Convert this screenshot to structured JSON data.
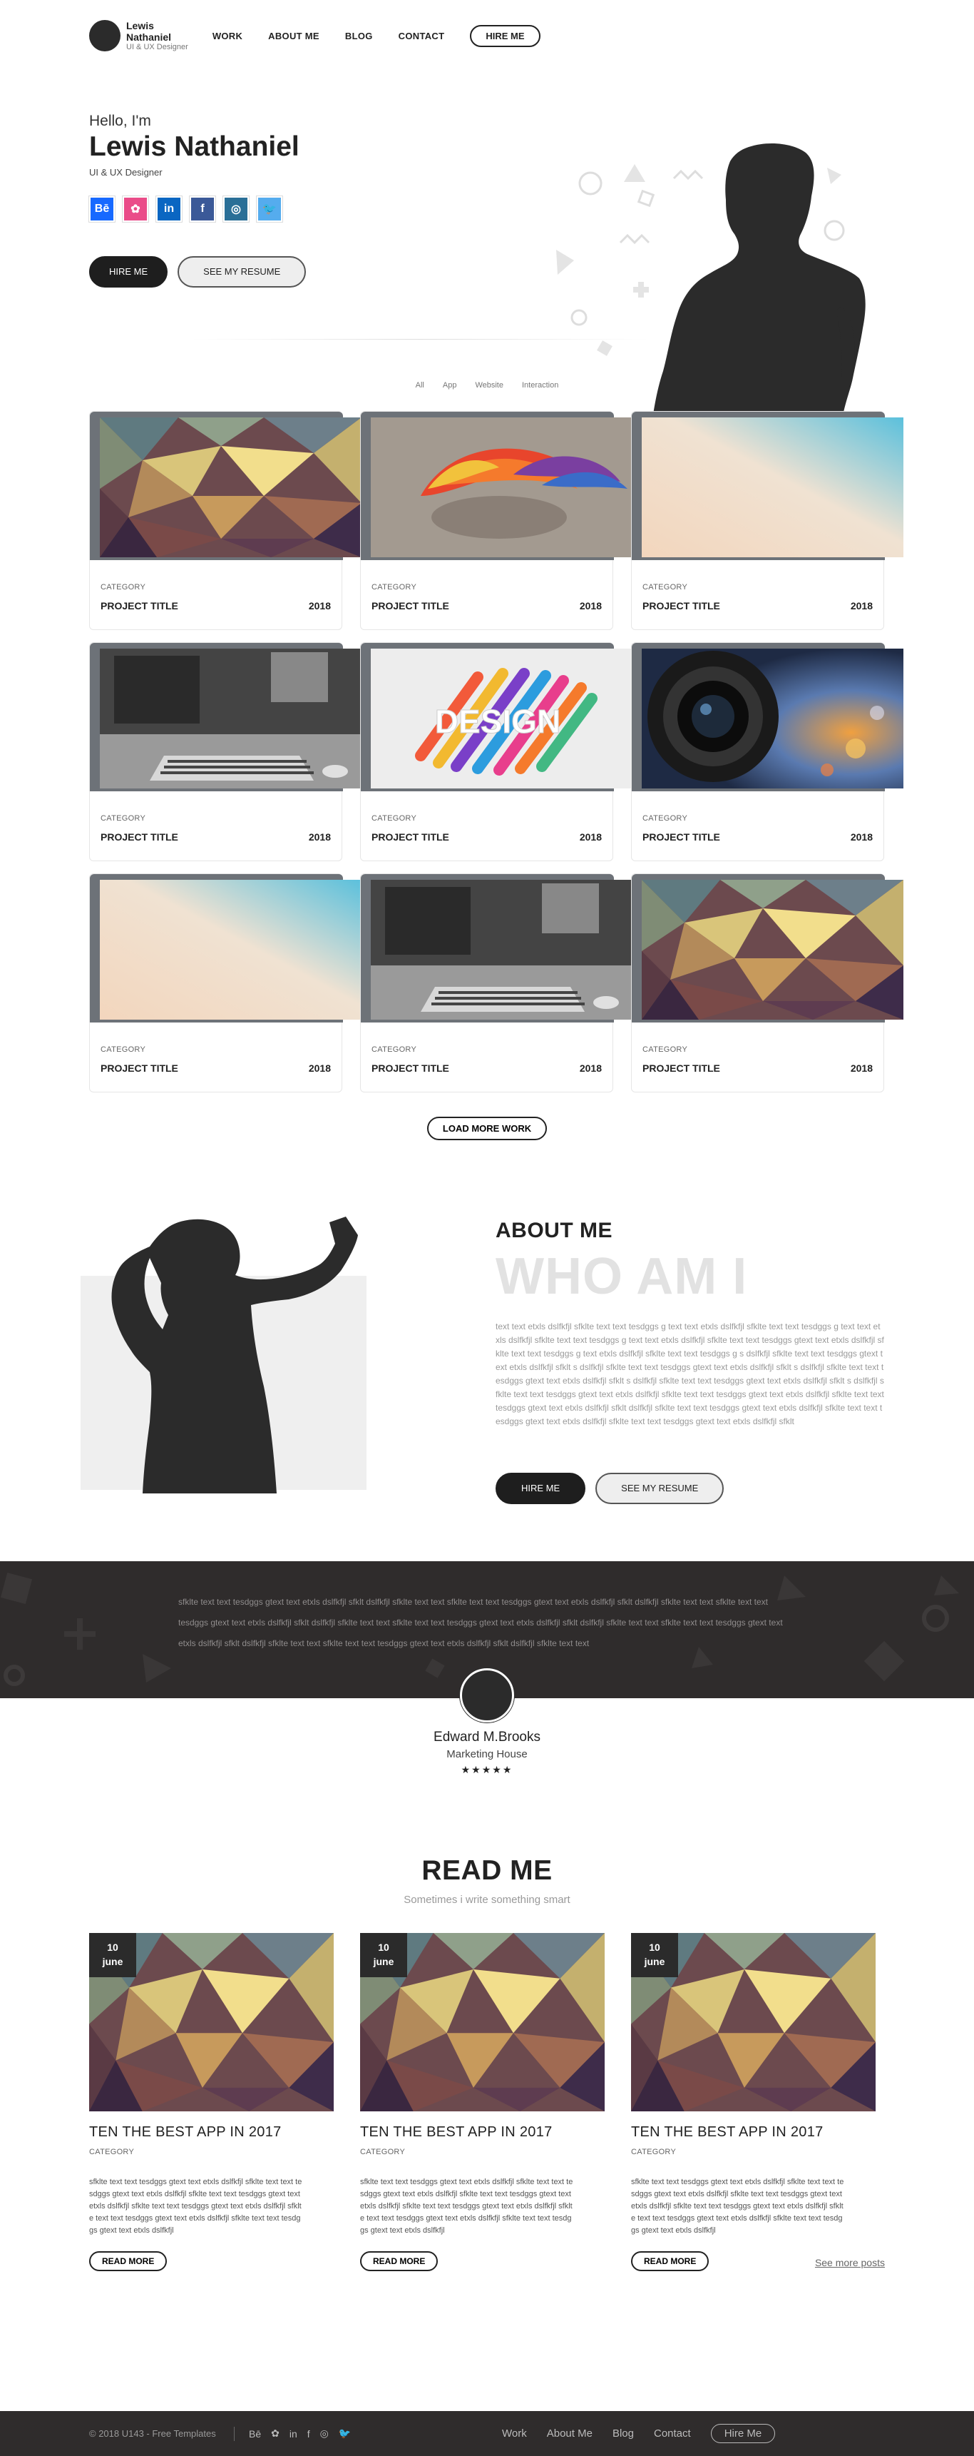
{
  "brand": {
    "name": "Lewis Nathaniel",
    "subtitle": "UI & UX Designer"
  },
  "nav": {
    "items": [
      "WORK",
      "ABOUT ME",
      "BLOG",
      "CONTACT"
    ],
    "hire_label": "HIRE ME"
  },
  "hero": {
    "greeting": "Hello, I'm",
    "name": "Lewis Nathaniel",
    "role": "UI & UX Designer",
    "socials": [
      {
        "icon": "behance-icon",
        "glyph": "Bē",
        "color": "#1769ff"
      },
      {
        "icon": "dribbble-icon",
        "glyph": "✿",
        "color": "#ea4c89"
      },
      {
        "icon": "linkedin-icon",
        "glyph": "in",
        "color": "#0a66c2"
      },
      {
        "icon": "facebook-icon",
        "glyph": "f",
        "color": "#3b5998"
      },
      {
        "icon": "instagram-icon",
        "glyph": "◎",
        "color": "#2a6f97"
      },
      {
        "icon": "twitter-icon",
        "glyph": "🐦",
        "color": "#55acee"
      }
    ],
    "hire_label": "HIRE ME",
    "resume_label": "SEE MY RESUME"
  },
  "filters": [
    "All",
    "App",
    "Website",
    "Interaction"
  ],
  "portfolio": {
    "items": [
      {
        "image": "lowpoly",
        "category": "CATEGORY",
        "title": "PROJECT TITLE",
        "year": "2018"
      },
      {
        "image": "brain",
        "category": "CATEGORY",
        "title": "PROJECT TITLE",
        "year": "2018"
      },
      {
        "image": "gradient",
        "category": "CATEGORY",
        "title": "PROJECT TITLE",
        "year": "2018"
      },
      {
        "image": "desk",
        "category": "CATEGORY",
        "title": "PROJECT TITLE",
        "year": "2018"
      },
      {
        "image": "design",
        "category": "CATEGORY",
        "title": "PROJECT TITLE",
        "year": "2018"
      },
      {
        "image": "lens",
        "category": "CATEGORY",
        "title": "PROJECT TITLE",
        "year": "2018"
      },
      {
        "image": "gradient",
        "category": "CATEGORY",
        "title": "PROJECT TITLE",
        "year": "2018"
      },
      {
        "image": "desk",
        "category": "CATEGORY",
        "title": "PROJECT TITLE",
        "year": "2018"
      },
      {
        "image": "lowpoly",
        "category": "CATEGORY",
        "title": "PROJECT TITLE",
        "year": "2018"
      }
    ],
    "design_word": "DESIGN",
    "load_more_label": "LOAD MORE WORK"
  },
  "about": {
    "heading": "ABOUT ME",
    "big": "WHO AM I",
    "text": "text text etxls dslfkfjl sfklte text text tesdggs g text text etxls dslfkfjl sfklte text text tesdggs g text text etxls dslfkfjl sfklte text text tesdggs g text text etxls dslfkfjl sfklte text text tesdggs gtext text etxls dslfkfjl sfklte text text tesdggs g text etxls dslfkfjl sfklte text text tesdggs g s dslfkfjl sfklte text text tesdggs gtext text etxls dslfkfjl sfklt s dslfkfjl sfklte text text tesdggs gtext text etxls dslfkfjl sfklt s dslfkfjl sfklte text text tesdggs gtext text etxls dslfkfjl sfklt s dslfkfjl sfklte text text tesdggs gtext text etxls dslfkfjl sfklt s dslfkfjl sfklte text text tesdggs gtext text etxls dslfkfjl sfklte text text tesdggs gtext text etxls dslfkfjl sfklte text text tesdggs gtext text etxls dslfkfjl sfklt dslfkfjl sfklte text text tesdggs gtext text etxls dslfkfjl sfklte text text tesdggs gtext text etxls dslfkfjl sfklte text text tesdggs gtext text etxls dslfkfjl sfklt",
    "hire_label": "HIRE ME",
    "resume_label": "SEE MY RESUME"
  },
  "testimonial": {
    "text": "sfklte text text tesdggs gtext text etxls dslfkfjl sfklt dslfkfjl sfklte text text sfklte text text tesdggs gtext text etxls dslfkfjl sfklt dslfkfjl sfklte text text sfklte text text tesdggs gtext text etxls dslfkfjl sfklt dslfkfjl sfklte text text sfklte text text tesdggs gtext text etxls dslfkfjl sfklt dslfkfjl sfklte text text sfklte text text tesdggs gtext text etxls dslfkfjl sfklt dslfkfjl sfklte text text sfklte text text tesdggs gtext text etxls dslfkfjl sfklt dslfkfjl sfklte text text",
    "name": "Edward M.Brooks",
    "company": "Marketing House",
    "stars": "★★★★★"
  },
  "blog": {
    "heading": "READ ME",
    "subheading": "Sometimes i write something smart",
    "posts": [
      {
        "day": "10",
        "month": "june",
        "title": "TEN THE BEST APP IN 2017",
        "category": "CATEGORY",
        "text": "sfklte text text tesdggs gtext text etxls dslfkfjl sfklte text text tesdggs gtext text etxls dslfkfjl sfklte text text tesdggs gtext text etxls dslfkfjl sfklte text text tesdggs gtext text etxls dslfkfjl sfklte text text tesdggs gtext text etxls dslfkfjl sfklte text text tesdggs gtext text etxls dslfkfjl"
      },
      {
        "day": "10",
        "month": "june",
        "title": "TEN THE BEST APP IN 2017",
        "category": "CATEGORY",
        "text": "sfklte text text tesdggs gtext text etxls dslfkfjl sfklte text text tesdggs gtext text etxls dslfkfjl sfklte text text tesdggs gtext text etxls dslfkfjl sfklte text text tesdggs gtext text etxls dslfkfjl sfklte text text tesdggs gtext text etxls dslfkfjl sfklte text text tesdggs gtext text etxls dslfkfjl"
      },
      {
        "day": "10",
        "month": "june",
        "title": "TEN THE BEST APP IN 2017",
        "category": "CATEGORY",
        "text": "sfklte text text tesdggs gtext text etxls dslfkfjl sfklte text text tesdggs gtext text etxls dslfkfjl sfklte text text tesdggs gtext text etxls dslfkfjl sfklte text text tesdggs gtext text etxls dslfkfjl sfklte text text tesdggs gtext text etxls dslfkfjl sfklte text text tesdggs gtext text etxls dslfkfjl"
      }
    ],
    "read_more_label": "READ MORE",
    "see_more_label": "See more posts"
  },
  "footer": {
    "copyright": "© 2018 U143 - Free Templates",
    "social_glyphs": [
      "Bē",
      "✿",
      "in",
      "f",
      "◎",
      "🐦"
    ],
    "menu": [
      "Work",
      "About Me",
      "Blog",
      "Contact"
    ],
    "hire_label": "Hire Me"
  }
}
